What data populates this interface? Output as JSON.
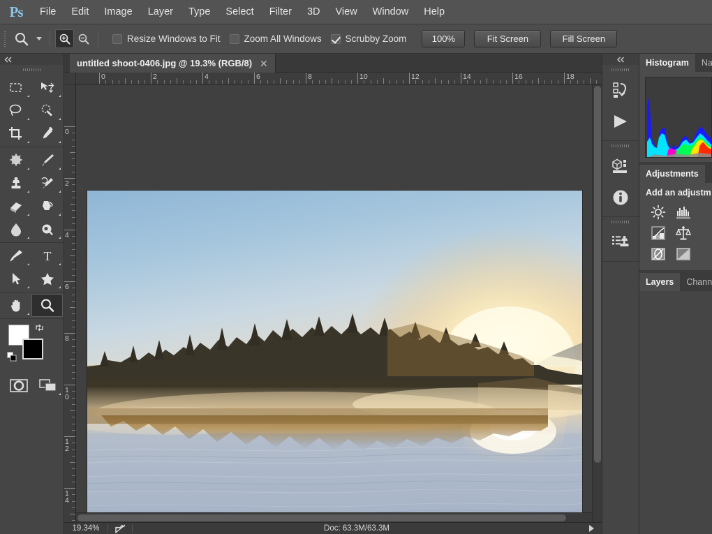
{
  "app": {
    "logo": "Ps",
    "title": "Adobe Photoshop"
  },
  "menubar": {
    "items": [
      "File",
      "Edit",
      "Image",
      "Layer",
      "Type",
      "Select",
      "Filter",
      "3D",
      "View",
      "Window",
      "Help"
    ]
  },
  "options_bar": {
    "active_tool_icon": "zoom-tool-icon",
    "preset_caret": "chevron-down-icon",
    "zoom_in_icon": "zoom-in-icon",
    "zoom_out_icon": "zoom-out-icon",
    "zoom_in_active": true,
    "checkboxes": [
      {
        "label": "Resize Windows to Fit",
        "checked": false
      },
      {
        "label": "Zoom All Windows",
        "checked": false
      },
      {
        "label": "Scrubby Zoom",
        "checked": true
      }
    ],
    "buttons": [
      "100%",
      "Fit Screen",
      "Fill Screen"
    ]
  },
  "toolbar": {
    "collapse_icon": "collapse-panel-icon",
    "groups": [
      [
        {
          "icon": "rectangular-marquee-icon",
          "has_flyout": true
        },
        {
          "icon": "move-tool-icon",
          "has_flyout": true
        },
        {
          "icon": "lasso-tool-icon",
          "has_flyout": true
        },
        {
          "icon": "quick-selection-icon",
          "has_flyout": true
        },
        {
          "icon": "crop-tool-icon",
          "has_flyout": true
        },
        {
          "icon": "eyedropper-icon",
          "has_flyout": true
        }
      ],
      [
        {
          "icon": "spot-healing-brush-icon",
          "has_flyout": true
        },
        {
          "icon": "brush-tool-icon",
          "has_flyout": true
        },
        {
          "icon": "clone-stamp-icon",
          "has_flyout": true
        },
        {
          "icon": "history-brush-icon",
          "has_flyout": true
        },
        {
          "icon": "eraser-tool-icon",
          "has_flyout": true
        },
        {
          "icon": "gradient-tool-icon",
          "has_flyout": true
        },
        {
          "icon": "blur-tool-icon",
          "has_flyout": true
        },
        {
          "icon": "dodge-tool-icon",
          "has_flyout": true
        }
      ],
      [
        {
          "icon": "pen-tool-icon",
          "has_flyout": true
        },
        {
          "icon": "type-tool-icon",
          "has_flyout": true
        },
        {
          "icon": "path-selection-icon",
          "has_flyout": true
        },
        {
          "icon": "custom-shape-icon",
          "has_flyout": true
        }
      ],
      [
        {
          "icon": "hand-tool-icon",
          "has_flyout": true
        },
        {
          "icon": "zoom-tool-icon",
          "has_flyout": false,
          "active": true
        }
      ]
    ],
    "foreground_color": "#ffffff",
    "background_color": "#000000",
    "swap_icon": "swap-colors-icon",
    "default_icon": "default-colors-icon",
    "quick_mask_icon": "quick-mask-icon",
    "screen_mode_icon": "screen-mode-icon"
  },
  "document": {
    "tab_title": "untitled shoot-0406.jpg @ 19.3% (RGB/8)",
    "close_icon": "close-icon",
    "ruler_units": "inches",
    "ruler_h_labels": [
      "0",
      "2",
      "4",
      "6",
      "8",
      "10",
      "12",
      "14",
      "16",
      "18"
    ],
    "ruler_v_labels": [
      "0",
      "2",
      "4",
      "6",
      "8",
      "10",
      "12",
      "14"
    ],
    "image_alt": "Misty lake at sunrise with pine tree island silhouette and sun reflection"
  },
  "status_bar": {
    "zoom_level": "19.34%",
    "share_icon": "share-icon",
    "doc_size": "Doc: 63.3M/63.3M",
    "expand_icon": "expand-arrow-icon"
  },
  "panel_rail": {
    "collapse_icon": "collapse-panels-icon",
    "groups": [
      [
        {
          "icon": "history-panel-icon"
        },
        {
          "icon": "actions-play-icon"
        }
      ],
      [
        {
          "icon": "3d-panel-icon"
        },
        {
          "icon": "info-panel-icon"
        }
      ],
      [
        {
          "icon": "clone-source-panel-icon"
        }
      ]
    ]
  },
  "panels": {
    "histogram": {
      "tabs": [
        {
          "label": "Histogram",
          "active": true
        },
        {
          "label": "Na",
          "active": false
        }
      ],
      "channel_colors": [
        "#1a1aff",
        "#00e5ff",
        "#ff00c8",
        "#00ff55",
        "#ffe500",
        "#ff2a00"
      ]
    },
    "adjustments": {
      "tabs": [
        {
          "label": "Adjustments",
          "active": true
        }
      ],
      "heading": "Add an adjustm",
      "icons": [
        "brightness-contrast-icon",
        "levels-icon",
        "curves-icon",
        "exposure-icon",
        "vibrance-icon",
        "hue-saturation-icon"
      ]
    },
    "layers": {
      "tabs": [
        {
          "label": "Layers",
          "active": true
        },
        {
          "label": "Chann",
          "active": false
        }
      ]
    }
  }
}
